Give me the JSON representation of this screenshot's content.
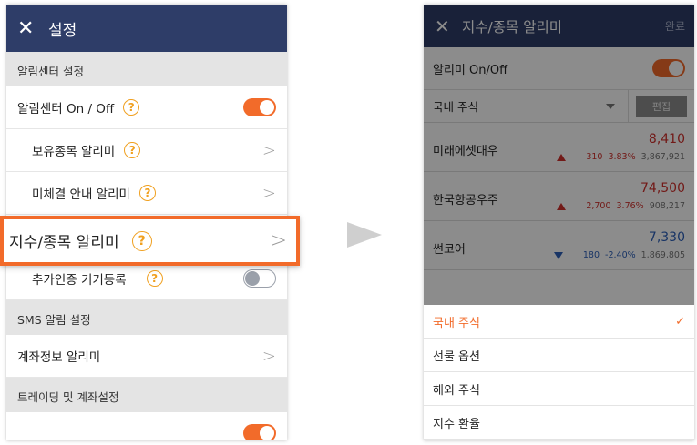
{
  "settings": {
    "header": {
      "close_icon": "close-icon",
      "title": "설정"
    },
    "section_alarm_center": "알림센터 설정",
    "alarm_center_toggle_label": "알림센터 On / Off",
    "alarm_center_on": true,
    "holdings_alarm_label": "보유종목 알리미",
    "unfilled_alarm_label": "미체결 안내 알리미",
    "index_alarm_label": "지수/종목 알리미",
    "extra_auth_label": "추가인증 기기등록",
    "extra_auth_on": false,
    "section_sms": "SMS 알림 설정",
    "account_alarm_label": "계좌정보 알리미",
    "section_trading": "트레이딩 및 계좌설정",
    "help_glyph": "?",
    "chevron": ">"
  },
  "index_alarm": {
    "header": {
      "title": "지수/종목 알리미",
      "done": "완료"
    },
    "onoff_label": "알리미 On/Off",
    "onoff_on": true,
    "market_select": "국내 주식",
    "edit_label": "편집",
    "stocks": [
      {
        "name": "미래에셋대우",
        "price": "8,410",
        "change": "310",
        "pct": "3.83%",
        "volume": "3,867,921",
        "dir": "up"
      },
      {
        "name": "한국항공우주",
        "price": "74,500",
        "change": "2,700",
        "pct": "3.76%",
        "volume": "908,217",
        "dir": "up"
      },
      {
        "name": "썬코어",
        "price": "7,330",
        "change": "180",
        "pct": "-2.40%",
        "volume": "1,869,805",
        "dir": "down"
      }
    ],
    "market_options": [
      {
        "label": "국내 주식",
        "selected": true
      },
      {
        "label": "선물 옵션",
        "selected": false
      },
      {
        "label": "해외 주식",
        "selected": false
      },
      {
        "label": "지수 환율",
        "selected": false
      }
    ],
    "check_glyph": "✓"
  },
  "colors": {
    "header_bg": "#2e3d68",
    "accent": "#f26b2a",
    "up": "#d0312d",
    "down": "#2c5fb8",
    "help": "#f0a020"
  }
}
